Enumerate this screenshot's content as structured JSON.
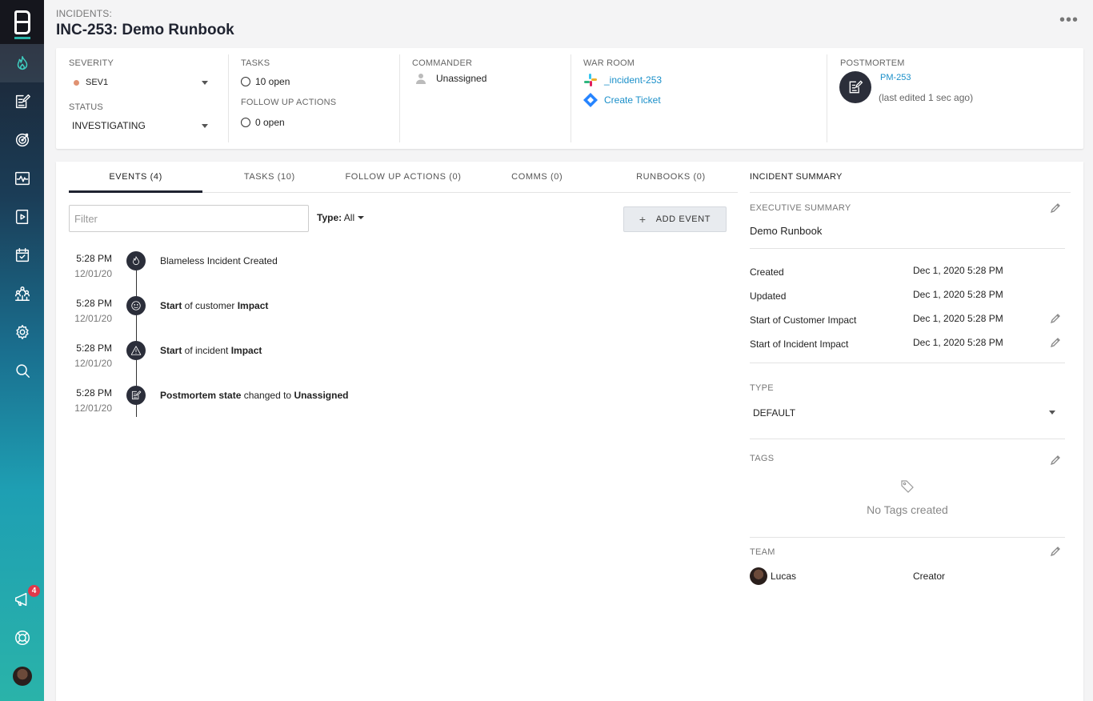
{
  "sidebar": {
    "notifications_badge": "4"
  },
  "header": {
    "breadcrumb": "INCIDENTS:",
    "title": "INC-253: Demo Runbook",
    "more_label": "•••"
  },
  "overview": {
    "severity_label": "SEVERITY",
    "severity_value": "SEV1",
    "status_label": "STATUS",
    "status_value": "INVESTIGATING",
    "tasks_label": "TASKS",
    "tasks_value": "10 open",
    "followup_label": "FOLLOW UP ACTIONS",
    "followup_value": "0 open",
    "commander_label": "COMMANDER",
    "commander_value": "Unassigned",
    "warroom_label": "WAR ROOM",
    "slack_channel": "_incident-253",
    "ticket_link": "Create Ticket",
    "postmortem_label": "POSTMORTEM",
    "postmortem_link": "PM-253",
    "postmortem_edited": "(last edited 1 sec ago)"
  },
  "tabs": [
    {
      "label": "EVENTS (4)"
    },
    {
      "label": "TASKS (10)"
    },
    {
      "label": "FOLLOW UP ACTIONS (0)"
    },
    {
      "label": "COMMS (0)"
    },
    {
      "label": "RUNBOOKS (0)"
    }
  ],
  "events_panel": {
    "filter_placeholder": "Filter",
    "type_label": "Type:",
    "type_value": "All",
    "add_event_label": "ADD EVENT"
  },
  "events": [
    {
      "time": "5:28 PM",
      "date": "12/01/20",
      "icon": "flame-icon",
      "p1": "Blameless Incident Created",
      "b1": "",
      "p2": "",
      "b2": ""
    },
    {
      "time": "5:28 PM",
      "date": "12/01/20",
      "icon": "smiley-icon",
      "p1": "",
      "b1": "Start",
      "p2": " of customer ",
      "b2": "Impact"
    },
    {
      "time": "5:28 PM",
      "date": "12/01/20",
      "icon": "warning-icon",
      "p1": "",
      "b1": "Start",
      "p2": " of incident ",
      "b2": "Impact"
    },
    {
      "time": "5:28 PM",
      "date": "12/01/20",
      "icon": "postmortem-icon",
      "p1": "",
      "b1": "Postmortem state",
      "p2": " changed to ",
      "b2": "Unassigned"
    }
  ],
  "summary": {
    "title": "INCIDENT SUMMARY",
    "exec_label": "EXECUTIVE SUMMARY",
    "exec_value": "Demo Runbook",
    "rows": [
      {
        "label": "Created",
        "value": "Dec 1, 2020 5:28 PM"
      },
      {
        "label": "Updated",
        "value": "Dec 1, 2020 5:28 PM"
      },
      {
        "label": "Start of Customer Impact",
        "value": "Dec 1, 2020 5:28 PM"
      },
      {
        "label": "Start of Incident Impact",
        "value": "Dec 1, 2020 5:28 PM"
      }
    ],
    "type_label": "TYPE",
    "type_value": "DEFAULT",
    "tags_label": "TAGS",
    "tags_empty": "No Tags created",
    "team_label": "TEAM",
    "team_member": "Lucas",
    "team_role": "Creator"
  },
  "colors": {
    "accent": "#1a8fc9",
    "severity_dot": "#e09272",
    "badge": "#e0384b"
  }
}
